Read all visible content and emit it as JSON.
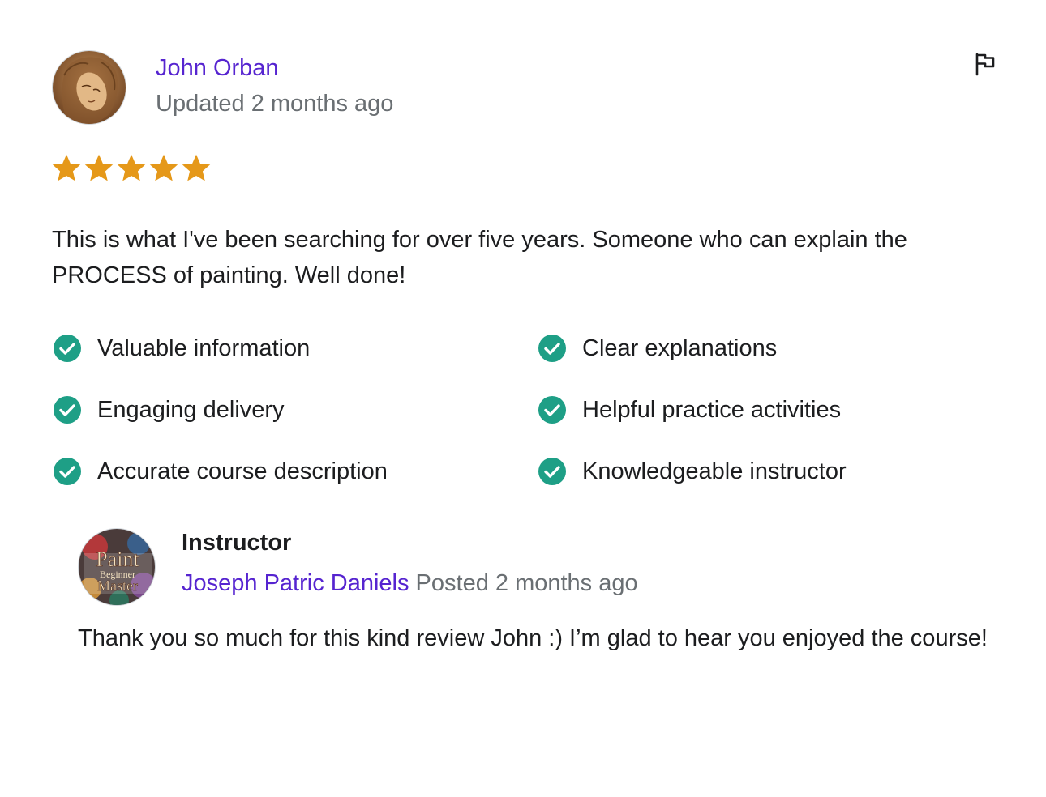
{
  "review": {
    "reviewer_name": "John Orban",
    "updated_text": "Updated 2 months ago",
    "rating": 5,
    "rating_max": 5,
    "star_color": "#e59819",
    "text": "This is what I've been searching for over five years. Someone who can explain the PROCESS of painting. Well done!",
    "tags": [
      {
        "label": "Valuable information"
      },
      {
        "label": "Clear explanations"
      },
      {
        "label": "Engaging delivery"
      },
      {
        "label": "Helpful practice activities"
      },
      {
        "label": "Accurate course description"
      },
      {
        "label": "Knowledgeable instructor"
      }
    ],
    "flag_icon": "flag-icon",
    "check_color": "#1e9f86"
  },
  "response": {
    "title": "Instructor",
    "instructor_name": "Joseph Patric Daniels",
    "posted_text": "Posted 2 months ago",
    "text": "Thank you so much for this kind review John :) I’m glad to hear you enjoyed the course!",
    "avatar_logo_lines": [
      "Paint",
      "Beginner",
      "Master"
    ]
  },
  "colors": {
    "link": "#5624d0",
    "muted": "#6a6f73",
    "text": "#1c1d1f"
  }
}
